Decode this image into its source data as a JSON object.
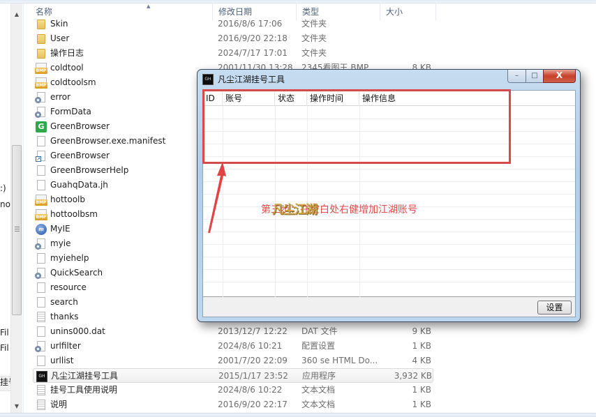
{
  "explorer": {
    "columns": {
      "name": "名称",
      "date": "修改日期",
      "type": "类型",
      "size": "大小"
    },
    "nav_fragments": [
      ":)",
      "not",
      "Fil",
      "Fil",
      "挂号"
    ],
    "files": [
      {
        "name": "Skin",
        "date": "2016/8/6 17:06",
        "type": "文件夹",
        "size": "",
        "icon": "folder-icon"
      },
      {
        "name": "User",
        "date": "2016/9/20 22:18",
        "type": "文件夹",
        "size": "",
        "icon": "folder-icon"
      },
      {
        "name": "操作日志",
        "date": "2024/7/17 17:01",
        "type": "文件夹",
        "size": "",
        "icon": "folder-icon"
      },
      {
        "name": "coldtool",
        "date": "2001/11/30 13:28",
        "type": "2345看图王 BMP...",
        "size": "8 KB",
        "icon": "bmp-icon"
      },
      {
        "name": "coldtoolsm",
        "date": "",
        "type": "",
        "size": "",
        "icon": "bmp-icon"
      },
      {
        "name": "error",
        "date": "",
        "type": "",
        "size": "",
        "icon": "config-file-icon"
      },
      {
        "name": "FormData",
        "date": "",
        "type": "",
        "size": "",
        "icon": "config-file-icon"
      },
      {
        "name": "GreenBrowser",
        "date": "",
        "type": "",
        "size": "",
        "icon": "greenbrowser-icon"
      },
      {
        "name": "GreenBrowser.exe.manifest",
        "date": "",
        "type": "",
        "size": "",
        "icon": "blank-file-icon"
      },
      {
        "name": "GreenBrowser",
        "date": "",
        "type": "",
        "size": "",
        "icon": "shortcut-icon"
      },
      {
        "name": "GreenBrowserHelp",
        "date": "",
        "type": "",
        "size": "",
        "icon": "blank-file-icon"
      },
      {
        "name": "GuahqData.jh",
        "date": "",
        "type": "",
        "size": "",
        "icon": "blank-file-icon"
      },
      {
        "name": "hottoolb",
        "date": "",
        "type": "",
        "size": "",
        "icon": "bmp-icon"
      },
      {
        "name": "hottoolbsm",
        "date": "",
        "type": "",
        "size": "",
        "icon": "bmp-icon"
      },
      {
        "name": "MyIE",
        "date": "",
        "type": "",
        "size": "",
        "icon": "myie-icon"
      },
      {
        "name": "myie",
        "date": "",
        "type": "",
        "size": "",
        "icon": "config-file-icon"
      },
      {
        "name": "myiehelp",
        "date": "",
        "type": "",
        "size": "",
        "icon": "blank-file-icon"
      },
      {
        "name": "QuickSearch",
        "date": "",
        "type": "",
        "size": "",
        "icon": "config-file-icon"
      },
      {
        "name": "resource",
        "date": "",
        "type": "",
        "size": "",
        "icon": "blank-file-icon"
      },
      {
        "name": "search",
        "date": "",
        "type": "",
        "size": "",
        "icon": "blank-file-icon"
      },
      {
        "name": "thanks",
        "date": "",
        "type": "",
        "size": "",
        "icon": "text-file-icon"
      },
      {
        "name": "unins000.dat",
        "date": "2013/12/7 12:22",
        "type": "DAT 文件",
        "size": "9 KB",
        "icon": "blank-file-icon"
      },
      {
        "name": "urlfilter",
        "date": "2024/8/6 10:21",
        "type": "配置设置",
        "size": "1 KB",
        "icon": "config-file-icon"
      },
      {
        "name": "urllist",
        "date": "2001/7/20 22:09",
        "type": "360 se HTML Do...",
        "size": "4 KB",
        "icon": "blank-file-icon"
      },
      {
        "name": "凡尘江湖挂号工具",
        "date": "2015/1/17 23:52",
        "type": "应用程序",
        "size": "3,932 KB",
        "icon": "app-icon",
        "selected": true
      },
      {
        "name": "挂号工具使用说明",
        "date": "2024/8/6 10:22",
        "type": "文本文档",
        "size": "1 KB",
        "icon": "text-file-icon"
      },
      {
        "name": "说明",
        "date": "2016/9/20 22:17",
        "type": "文本文档",
        "size": "1 KB",
        "icon": "text-file-icon"
      }
    ]
  },
  "dialog": {
    "title": "凡尘江湖挂号工具",
    "icon_text": "GH",
    "controls": {
      "minimize": "–",
      "maximize": "□",
      "close": "X"
    },
    "list_columns": [
      "ID",
      "账号",
      "状态",
      "操作时间",
      "操作信息"
    ],
    "settings_button": "设置"
  },
  "annotation": {
    "instruction": "第三步：在空白处右健增加江湖账号",
    "watermark": "凡尘江湖",
    "highlight_color": "#d84a4a"
  }
}
